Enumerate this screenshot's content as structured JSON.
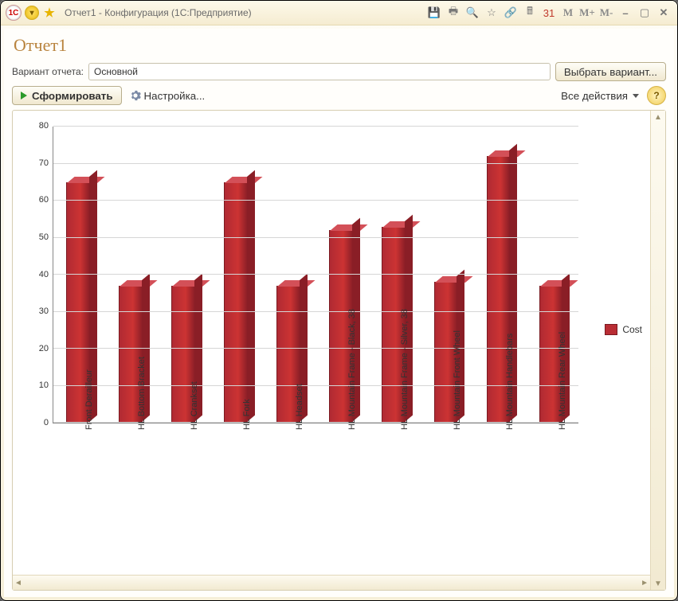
{
  "titlebar": {
    "title": "Отчет1 - Конфигурация  (1С:Предприятие)",
    "m1": "M",
    "m2": "M+",
    "m3": "M-"
  },
  "page": {
    "title": "Отчет1"
  },
  "variant": {
    "label": "Вариант отчета:",
    "value": "Основной",
    "choose": "Выбрать вариант..."
  },
  "toolbar": {
    "run": "Сформировать",
    "settings": "Настройка...",
    "all_actions": "Все действия",
    "help": "?"
  },
  "legend": {
    "label": "Cost"
  },
  "chart_data": {
    "type": "bar",
    "title": "",
    "xlabel": "",
    "ylabel": "",
    "ylim": [
      0,
      80
    ],
    "yticks": [
      0,
      10,
      20,
      30,
      40,
      50,
      60,
      70,
      80
    ],
    "series": [
      {
        "name": "Cost",
        "values": [
          65,
          37,
          37,
          65,
          37,
          52,
          53,
          38,
          72,
          37
        ]
      }
    ],
    "categories": [
      "Front Derailleur",
      "HL Bottom Bracket",
      "HL Crankset",
      "HL Fork",
      "HL Headset",
      "HL Mountain Frame - Black, 38",
      "HL Mountain Frame - Silver, 38",
      "HL Mountain Front Wheel",
      "HL Mountain Handlebars",
      "HL Mountain Rear Wheel"
    ]
  }
}
